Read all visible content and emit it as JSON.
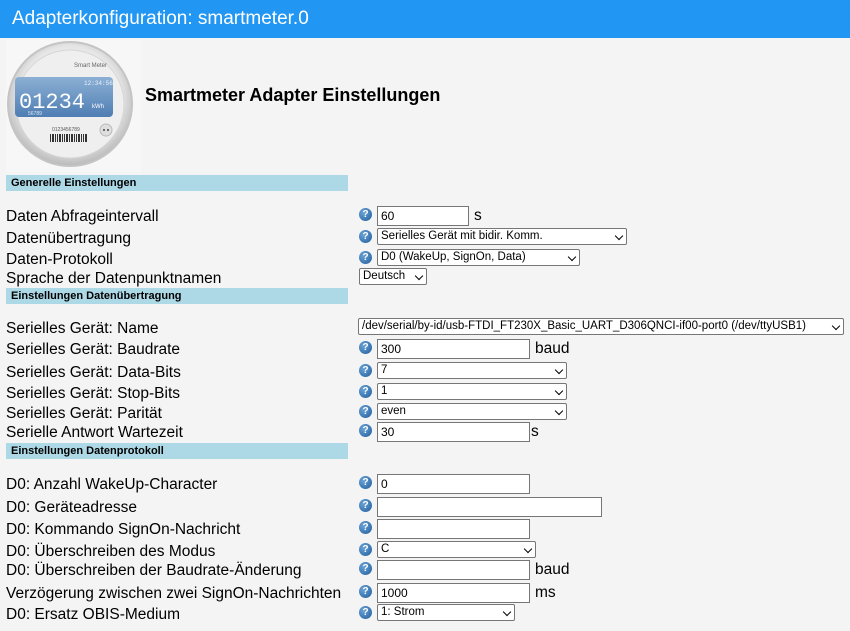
{
  "window": {
    "title": "Adapterkonfiguration: smartmeter.0"
  },
  "header": {
    "title": "Smartmeter Adapter Einstellungen",
    "logo": {
      "brand": "Smart Meter",
      "time": "12:34:56",
      "reading": "01234",
      "unit": "kWh",
      "small_number": "56789",
      "serial": "0123456789"
    }
  },
  "sections": {
    "general": "Generelle Einstellungen",
    "transfer": "Einstellungen Datenübertragung",
    "protocol": "Einstellungen Datenprotokoll"
  },
  "general": {
    "interval_label": "Daten Abfrageintervall",
    "interval_value": "60",
    "interval_unit": "s",
    "transfer_label": "Datenübertragung",
    "transfer_value": "Serielles Gerät mit bidir. Komm.",
    "protocol_label": "Daten-Protokoll",
    "protocol_value": "D0 (WakeUp, SignOn, Data)",
    "language_label": "Sprache der Datenpunktnamen",
    "language_value": "Deutsch"
  },
  "transfer": {
    "device_label": "Serielles Gerät: Name",
    "device_value": "/dev/serial/by-id/usb-FTDI_FT230X_Basic_UART_D306QNCI-if00-port0 (/dev/ttyUSB1)",
    "baud_label": "Serielles Gerät: Baudrate",
    "baud_value": "300",
    "baud_unit": "baud",
    "databits_label": "Serielles Gerät: Data-Bits",
    "databits_value": "7",
    "stopbits_label": "Serielles Gerät: Stop-Bits",
    "stopbits_value": "1",
    "parity_label": "Serielles Gerät: Parität",
    "parity_value": "even",
    "wait_label": "Serielle Antwort Wartezeit",
    "wait_value": "30",
    "wait_unit": "s"
  },
  "protocol": {
    "wakeup_label": "D0: Anzahl WakeUp-Character",
    "wakeup_value": "0",
    "address_label": "D0: Geräteadresse",
    "address_value": "",
    "signon_label": "D0: Kommando SignOn-Nachricht",
    "signon_value": "",
    "mode_label": "D0: Überschreiben des Modus",
    "mode_value": "C",
    "baudchange_label": "D0: Überschreiben der Baudrate-Änderung",
    "baudchange_value": "",
    "baudchange_unit": "baud",
    "delay_label": "Verzögerung zwischen zwei SignOn-Nachrichten",
    "delay_value": "1000",
    "delay_unit": "ms",
    "obis_label": "D0: Ersatz OBIS-Medium",
    "obis_value": "1: Strom"
  },
  "help_glyph": "?",
  "colors": {
    "titlebar": "#2196f3",
    "section": "#add8e6",
    "help": "#1f5c99"
  }
}
